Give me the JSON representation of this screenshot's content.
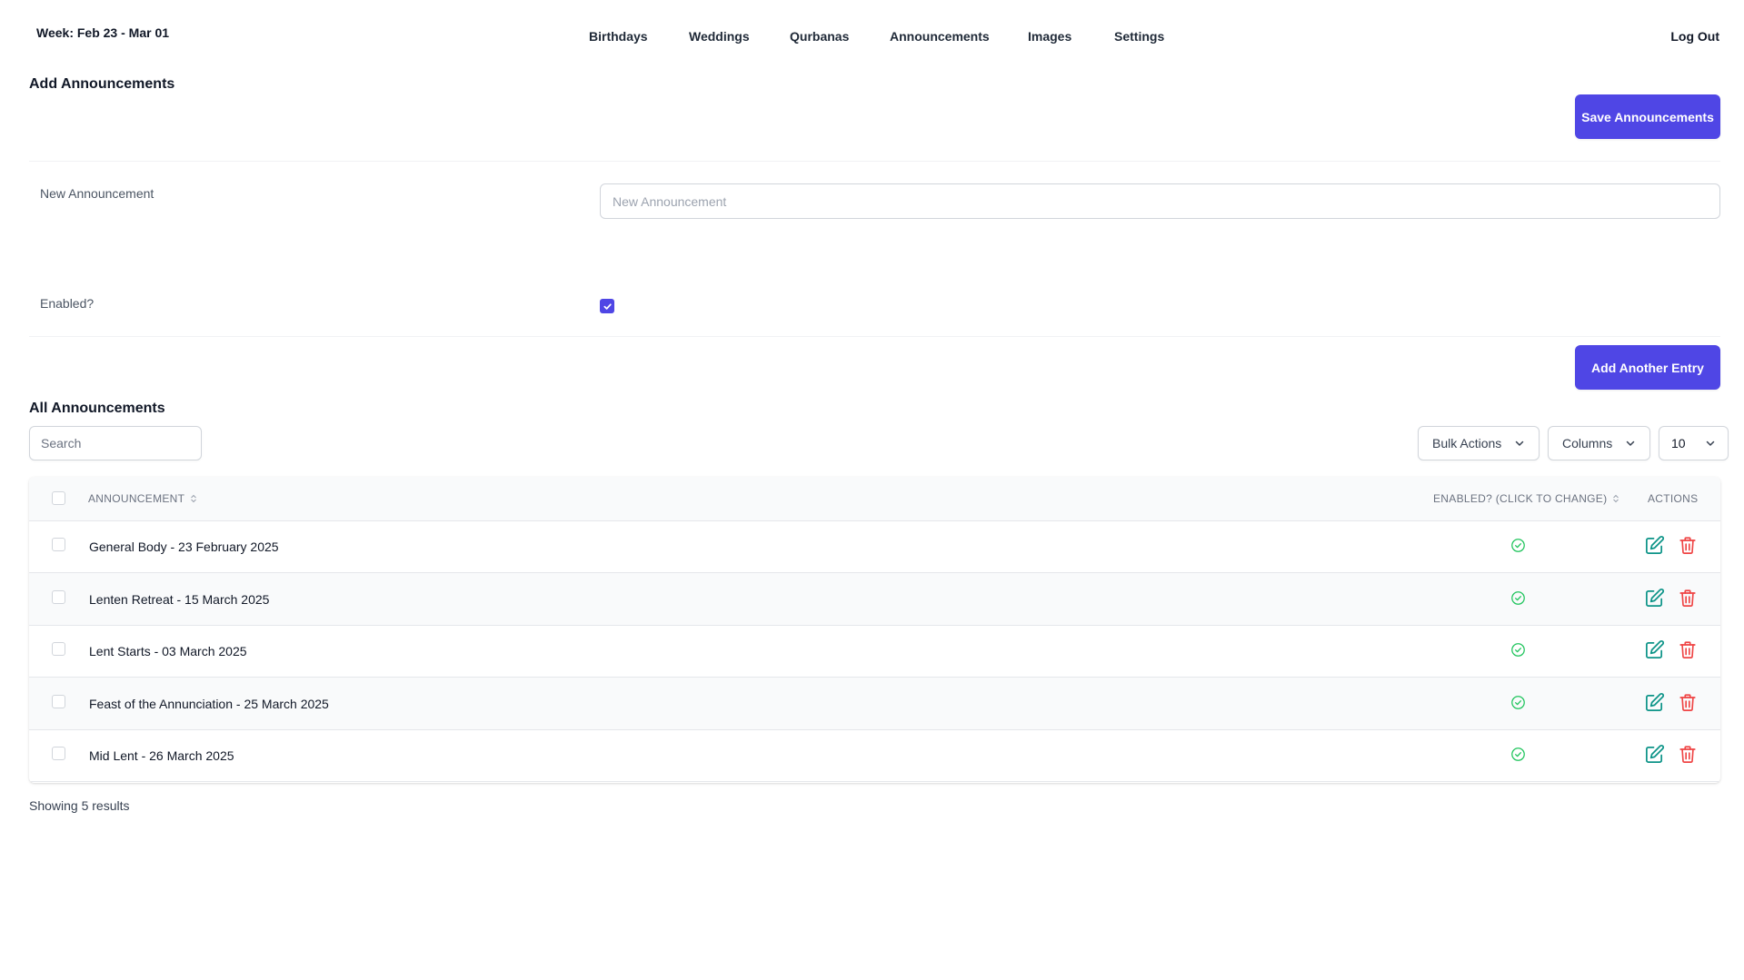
{
  "header": {
    "week": "Week: Feb 23 - Mar 01",
    "nav": [
      "Birthdays",
      "Weddings",
      "Qurbanas",
      "Announcements",
      "Images",
      "Settings"
    ],
    "logout": "Log Out"
  },
  "form": {
    "title": "Add Announcements",
    "save_label": "Save Announcements",
    "announcement_label": "New Announcement",
    "announcement_placeholder": "New Announcement",
    "announcement_value": "",
    "enabled_label": "Enabled?",
    "enabled_checked": true,
    "add_label": "Add Another Entry"
  },
  "list": {
    "title": "All Announcements",
    "search_placeholder": "Search",
    "bulk_label": "Bulk Actions",
    "columns_label": "Columns",
    "per_page": "10",
    "headers": {
      "announcement": "ANNOUNCEMENT",
      "enabled": "ENABLED? (CLICK TO CHANGE)",
      "actions": "ACTIONS"
    },
    "rows": [
      {
        "announcement": "General Body - 23 February 2025",
        "enabled": true
      },
      {
        "announcement": "Lenten Retreat - 15 March 2025",
        "enabled": true
      },
      {
        "announcement": "Lent Starts - 03 March 2025",
        "enabled": true
      },
      {
        "announcement": "Feast of the Annunciation - 25 March 2025",
        "enabled": true
      },
      {
        "announcement": "Mid Lent - 26 March 2025",
        "enabled": true
      }
    ],
    "footer": "Showing 5 results"
  },
  "colors": {
    "primary": "#4f46e5",
    "success": "#22c55e",
    "edit": "#0d9488",
    "delete": "#ef4444"
  },
  "icons": {
    "enabled": "check-circle-icon",
    "edit": "edit-icon",
    "delete": "trash-icon",
    "dropdown": "chevron-down-icon",
    "sort": "sort-icon"
  }
}
